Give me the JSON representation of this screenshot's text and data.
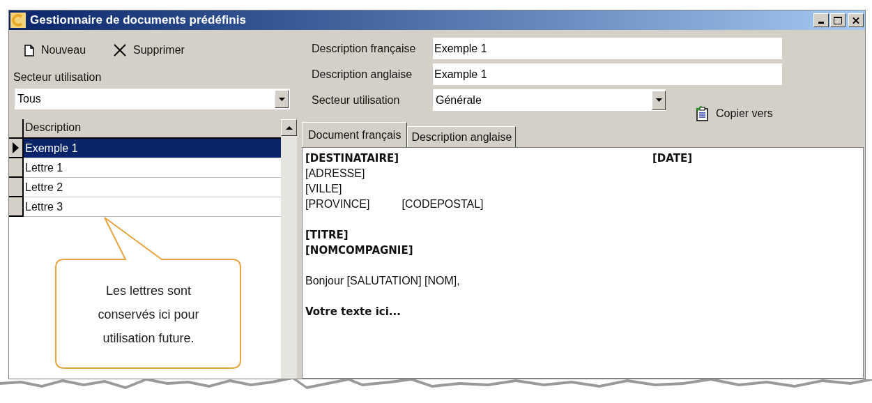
{
  "window": {
    "title": "Gestionnaire de documents prédéfinis"
  },
  "toolbar": [
    {
      "label": "Nouveau",
      "kind": "new"
    },
    {
      "label": "Supprimer",
      "kind": "delete"
    }
  ],
  "filter": {
    "label": "Secteur utilisation",
    "value": "Tous"
  },
  "grid": {
    "column": "Description",
    "rows": [
      {
        "text": "Exemple 1",
        "selected": true
      },
      {
        "text": "Lettre 1",
        "selected": false
      },
      {
        "text": "Lettre 2",
        "selected": false
      },
      {
        "text": "Lettre 3",
        "selected": false
      }
    ]
  },
  "callout": {
    "text": "Les lettres sont conservés ici pour utilisation future."
  },
  "form": {
    "fields": [
      {
        "label": "Description française",
        "value": "Exemple 1",
        "kind": "text"
      },
      {
        "label": "Description anglaise",
        "value": "Example 1",
        "kind": "text"
      },
      {
        "label": "Secteur utilisation",
        "value": "Générale",
        "kind": "combo"
      }
    ]
  },
  "copy_button": {
    "label": "Copier vers"
  },
  "tabs": [
    {
      "label": "Document français",
      "selected": true
    },
    {
      "label": "Description anglaise",
      "selected": false
    }
  ],
  "document": {
    "paragraphs": [
      {
        "lines": [
          {
            "kind": "header",
            "bold": true,
            "cells": [
              "[DESTINATAIRE]",
              "[DATE]"
            ]
          },
          {
            "kind": "plain",
            "bold": false,
            "cells": [
              "[ADRESSE]"
            ]
          },
          {
            "kind": "plain",
            "bold": false,
            "cells": [
              "[VILLE]"
            ]
          },
          {
            "kind": "plain",
            "bold": false,
            "cells": [
              "[PROVINCE]",
              "[CODEPOSTAL]"
            ]
          }
        ]
      },
      {
        "lines": [
          {
            "kind": "plain",
            "bold": true,
            "cells": [
              "[TITRE]"
            ]
          },
          {
            "kind": "plain",
            "bold": true,
            "cells": [
              "[NOMCOMPAGNIE]"
            ]
          }
        ]
      },
      {
        "lines": [
          {
            "kind": "plain",
            "bold": false,
            "cells": [
              "Bonjour [SALUTATION] [NOM],"
            ]
          }
        ]
      },
      {
        "lines": [
          {
            "kind": "plain",
            "bold": true,
            "cells": [
              "Votre texte ici..."
            ]
          }
        ]
      }
    ]
  }
}
